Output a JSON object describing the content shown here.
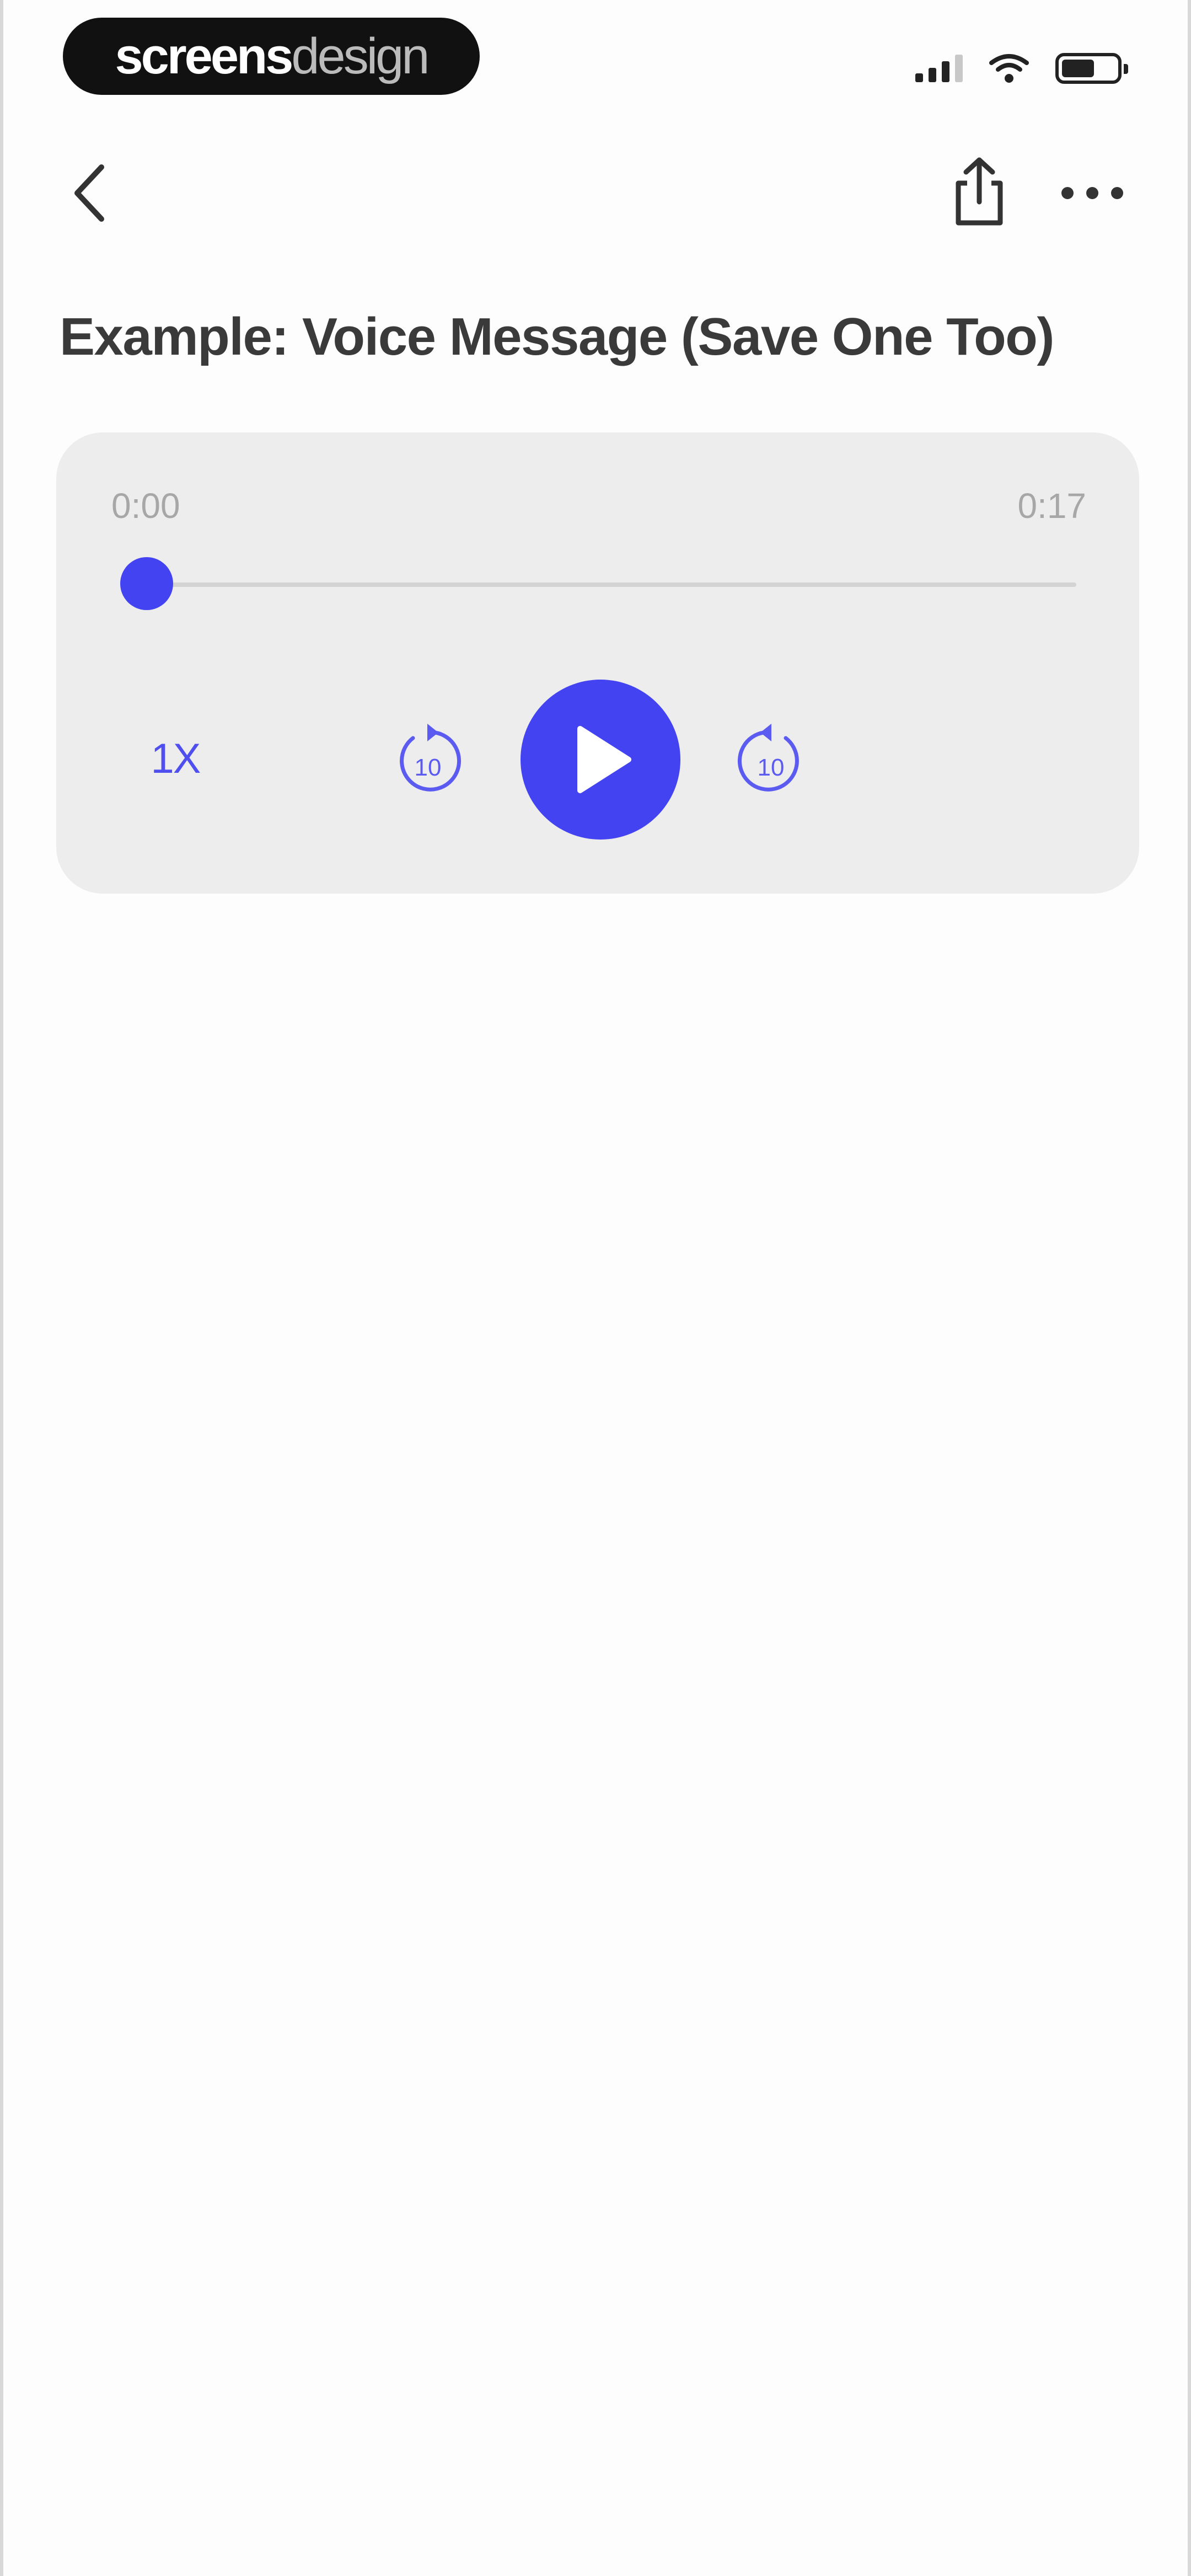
{
  "status_bar": {
    "brand_part1": "screens",
    "brand_part2": "design"
  },
  "nav": {
    "back_icon": "chevron-left-icon",
    "share_icon": "share-icon",
    "more_icon": "ellipsis-icon"
  },
  "page": {
    "title": "Example: Voice Message (Save One Too)"
  },
  "player": {
    "current_time": "0:00",
    "duration": "0:17",
    "progress": 0,
    "speed_label": "1X",
    "skip_back_label": "10",
    "skip_forward_label": "10",
    "accent_color": "#4343f1"
  },
  "colors": {
    "accent": "#4343f1",
    "card_bg": "#ededed",
    "title_text": "#3a3a3a"
  }
}
